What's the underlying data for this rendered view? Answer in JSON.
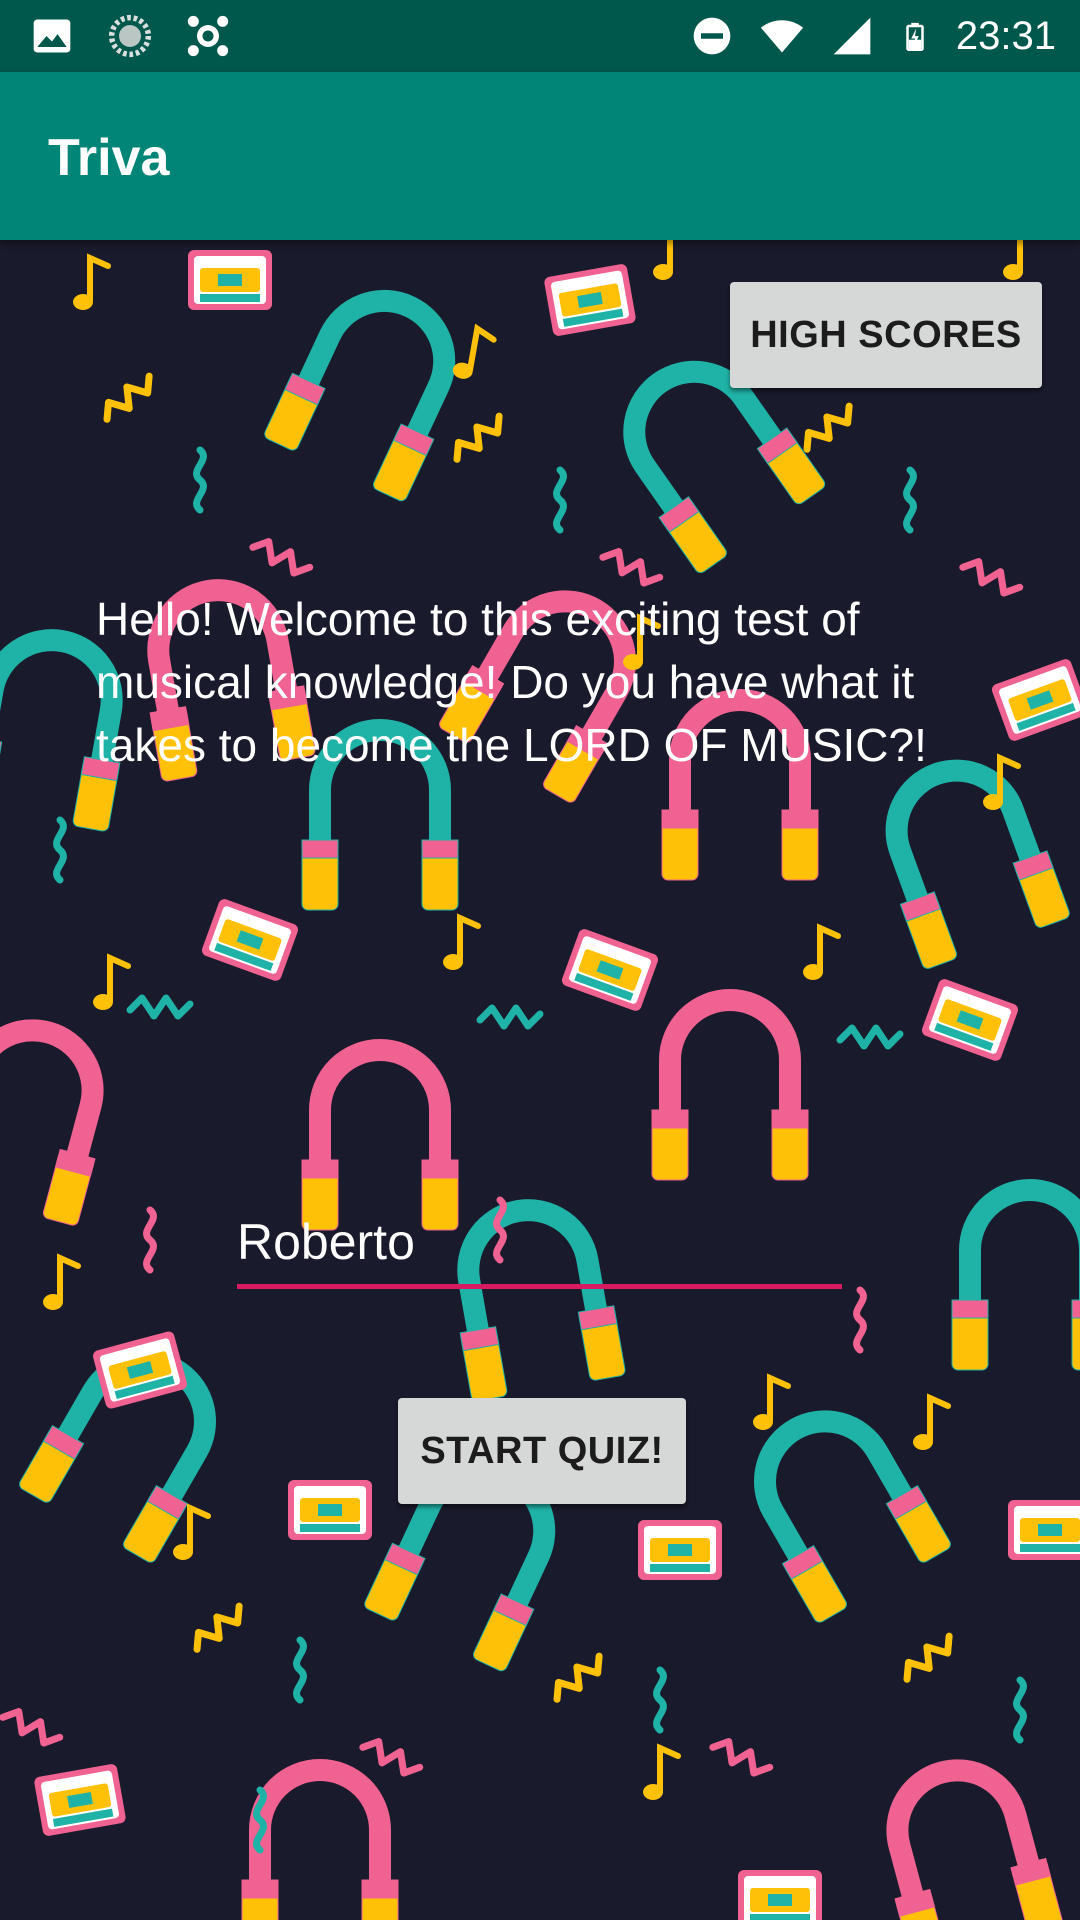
{
  "status_bar": {
    "time": "23:31",
    "left_icons": [
      "image-icon",
      "loading-circle-icon",
      "app-notification-icon"
    ],
    "right_icons": [
      "do-not-disturb-icon",
      "wifi-icon",
      "cell-signal-icon",
      "battery-charging-icon"
    ]
  },
  "app_bar": {
    "title": "Triva",
    "color": "#008577",
    "status_color": "#00574b"
  },
  "main": {
    "high_scores_label": "HIGH SCORES",
    "welcome_message": "Hello! Welcome to this exciting test of musical knowledge! Do you have what it takes to become the LORD OF MUSIC?!",
    "name_input": {
      "value": "Roberto",
      "underline_color": "#d81b60"
    },
    "start_label": "START QUIZ!",
    "background": {
      "description_colors": [
        "#191a2b",
        "#1fb2a6",
        "#f06292",
        "#ffc107"
      ]
    }
  }
}
